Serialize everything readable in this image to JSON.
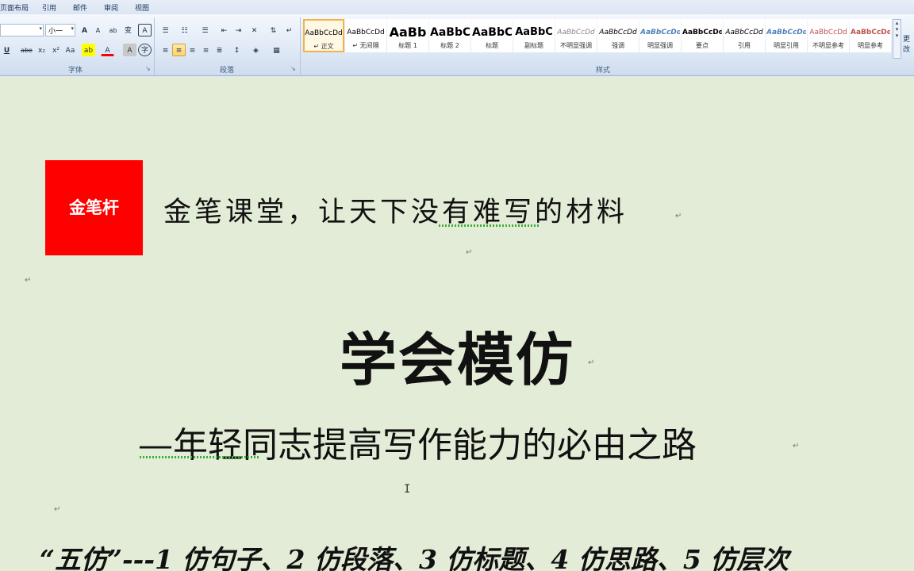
{
  "menu": {
    "tabs": [
      "页面布局",
      "引用",
      "邮件",
      "审阅",
      "视图"
    ]
  },
  "ribbon": {
    "font_group": {
      "label": "字体",
      "font_name": "",
      "font_size": "小一",
      "buttons_row1": [
        "A",
        "A",
        "ab",
        "变",
        "A"
      ],
      "buttons_row2": [
        "U",
        "abe",
        "x₂",
        "x²",
        "Aa",
        "ab",
        "A",
        "A",
        "字"
      ]
    },
    "paragraph_group": {
      "label": "段落"
    },
    "styles_group": {
      "label": "样式",
      "items": [
        {
          "sample": "AaBbCcDd",
          "name": "↵ 正文",
          "selected": true,
          "color": "#000000",
          "size": 9,
          "weight": "normal",
          "italic": false
        },
        {
          "sample": "AaBbCcDd",
          "name": "↵ 无间隔",
          "selected": false,
          "color": "#000000",
          "size": 9,
          "weight": "normal",
          "italic": false
        },
        {
          "sample": "AaBb",
          "name": "标题 1",
          "selected": false,
          "color": "#000000",
          "size": 16,
          "weight": "bold",
          "italic": false
        },
        {
          "sample": "AaBbC",
          "name": "标题 2",
          "selected": false,
          "color": "#000000",
          "size": 14,
          "weight": "bold",
          "italic": false
        },
        {
          "sample": "AaBbC",
          "name": "标题",
          "selected": false,
          "color": "#000000",
          "size": 14,
          "weight": "bold",
          "italic": false
        },
        {
          "sample": "AaBbC",
          "name": "副标题",
          "selected": false,
          "color": "#000000",
          "size": 13,
          "weight": "bold",
          "italic": false
        },
        {
          "sample": "AaBbCcDd",
          "name": "不明显强调",
          "selected": false,
          "color": "#888888",
          "size": 9,
          "weight": "normal",
          "italic": true
        },
        {
          "sample": "AaBbCcDd",
          "name": "强调",
          "selected": false,
          "color": "#000000",
          "size": 9,
          "weight": "normal",
          "italic": true
        },
        {
          "sample": "AaBbCcDd",
          "name": "明显强调",
          "selected": false,
          "color": "#4f81bd",
          "size": 9,
          "weight": "bold",
          "italic": true
        },
        {
          "sample": "AaBbCcDd",
          "name": "要点",
          "selected": false,
          "color": "#000000",
          "size": 9,
          "weight": "bold",
          "italic": false
        },
        {
          "sample": "AaBbCcDd",
          "name": "引用",
          "selected": false,
          "color": "#000000",
          "size": 9,
          "weight": "normal",
          "italic": true
        },
        {
          "sample": "AaBbCcDd",
          "name": "明显引用",
          "selected": false,
          "color": "#4f81bd",
          "size": 9,
          "weight": "bold",
          "italic": true
        },
        {
          "sample": "AaBbCcDd",
          "name": "不明显参考",
          "selected": false,
          "color": "#c0504d",
          "size": 9,
          "weight": "normal",
          "italic": false
        },
        {
          "sample": "AaBbCcDd",
          "name": "明显参考",
          "selected": false,
          "color": "#c0504d",
          "size": 9,
          "weight": "bold",
          "italic": false
        }
      ]
    },
    "edit_more": "更改"
  },
  "document": {
    "logo_text": "金笔杆",
    "slogan": "金笔课堂，让天下没有难写的材料",
    "title": "学会模仿",
    "subtitle": "—年轻同志提高写作能力的必由之路",
    "bottom_line": "“五仿”---1 仿句子、2 仿段落、3 仿标题、4 仿思路、5 仿层次"
  },
  "colors": {
    "logo_bg": "#ff0000",
    "doc_bg": "#e2ecd6",
    "ribbon_bg": "#dbe6f4"
  }
}
